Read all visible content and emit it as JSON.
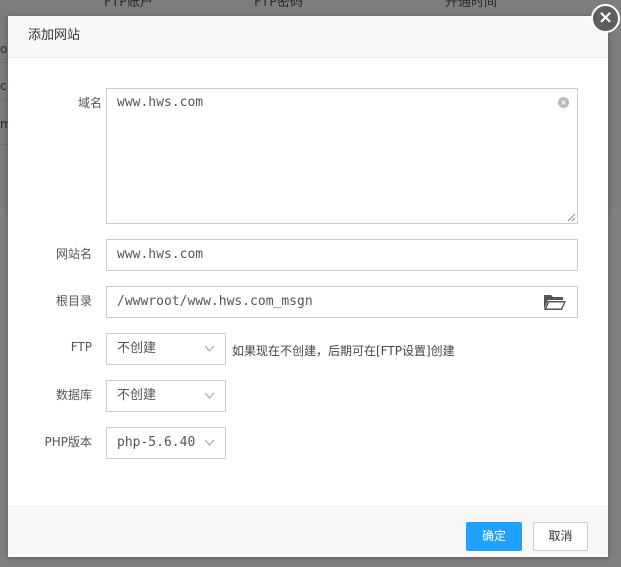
{
  "background": {
    "headers": [
      "FTP账户",
      "FTP密码",
      "开通时间"
    ],
    "row_fragments": [
      "o",
      "c",
      "m"
    ]
  },
  "dialog": {
    "title": "添加网站",
    "close_label": "×"
  },
  "form": {
    "domain": {
      "label": "域名",
      "value": "www.hws.com"
    },
    "site_name": {
      "label": "网站名",
      "value": "www.hws.com"
    },
    "root_dir": {
      "label": "根目录",
      "value": "/wwwroot/www.hws.com_msgn"
    },
    "ftp": {
      "label": "FTP",
      "selected": "不创建",
      "hint": "如果现在不创建，后期可在[FTP设置]创建"
    },
    "database": {
      "label": "数据库",
      "selected": "不创建"
    },
    "php": {
      "label": "PHP版本",
      "selected": "php-5.6.40"
    }
  },
  "footer": {
    "ok_label": "确定",
    "cancel_label": "取消"
  },
  "colors": {
    "primary": "#20a0ff",
    "overlay": "#808080"
  },
  "icons": {
    "close": "close-icon",
    "clear": "clear-icon",
    "folder": "folder-open-icon",
    "dropdown": "chevron-down-icon"
  }
}
